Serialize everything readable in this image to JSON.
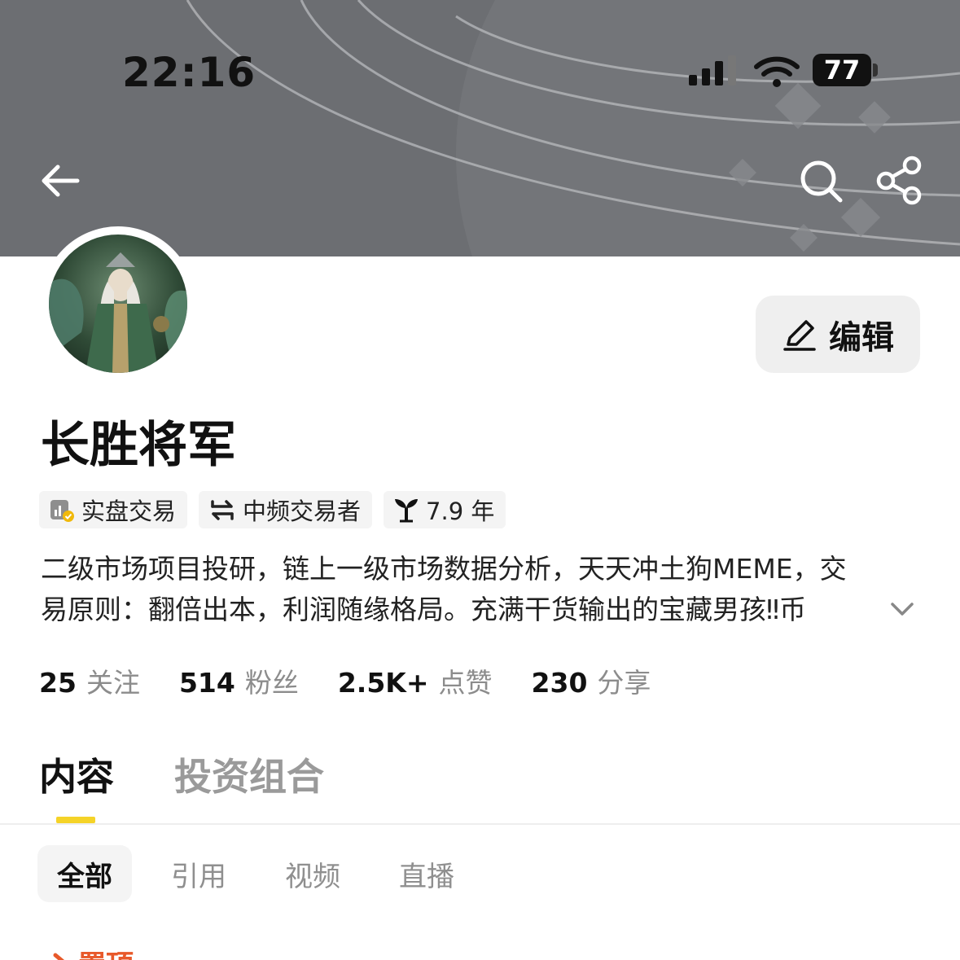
{
  "status_bar": {
    "time": "22:16",
    "battery": "77",
    "icons": [
      "signal-icon",
      "wifi-icon",
      "battery-icon"
    ]
  },
  "nav": {
    "back_icon": "arrow-left-icon",
    "search_icon": "search-icon",
    "share_icon": "share-icon"
  },
  "profile": {
    "name": "长胜将军",
    "edit_label": "编辑",
    "edit_icon": "pencil-icon",
    "tags": [
      {
        "label": "实盘交易",
        "icon": "verified-trading-icon"
      },
      {
        "label": "中频交易者",
        "icon": "swap-arrows-icon"
      },
      {
        "label": "7.9 年",
        "icon": "sprout-icon"
      }
    ],
    "bio_line1": "二级市场项目投研，链上一级市场数据分析，天天冲土狗MEME，交",
    "bio_line2": "易原则：翻倍出本，利润随缘格局。充满干货输出的宝藏男孩‼币"
  },
  "stats": [
    {
      "value": "25",
      "label": "关注"
    },
    {
      "value": "514",
      "label": "粉丝"
    },
    {
      "value": "2.5K+",
      "label": "点赞"
    },
    {
      "value": "230",
      "label": "分享"
    }
  ],
  "main_tabs": [
    {
      "label": "内容",
      "active": true
    },
    {
      "label": "投资组合",
      "active": false
    }
  ],
  "sub_tabs": [
    {
      "label": "全部",
      "active": true
    },
    {
      "label": "引用",
      "active": false
    },
    {
      "label": "视频",
      "active": false
    },
    {
      "label": "直播",
      "active": false
    }
  ],
  "pinned_label": "置顶",
  "colors": {
    "banner": "#6c6e72",
    "accent_yellow": "#f5d328",
    "pinned_orange": "#e8592a"
  }
}
